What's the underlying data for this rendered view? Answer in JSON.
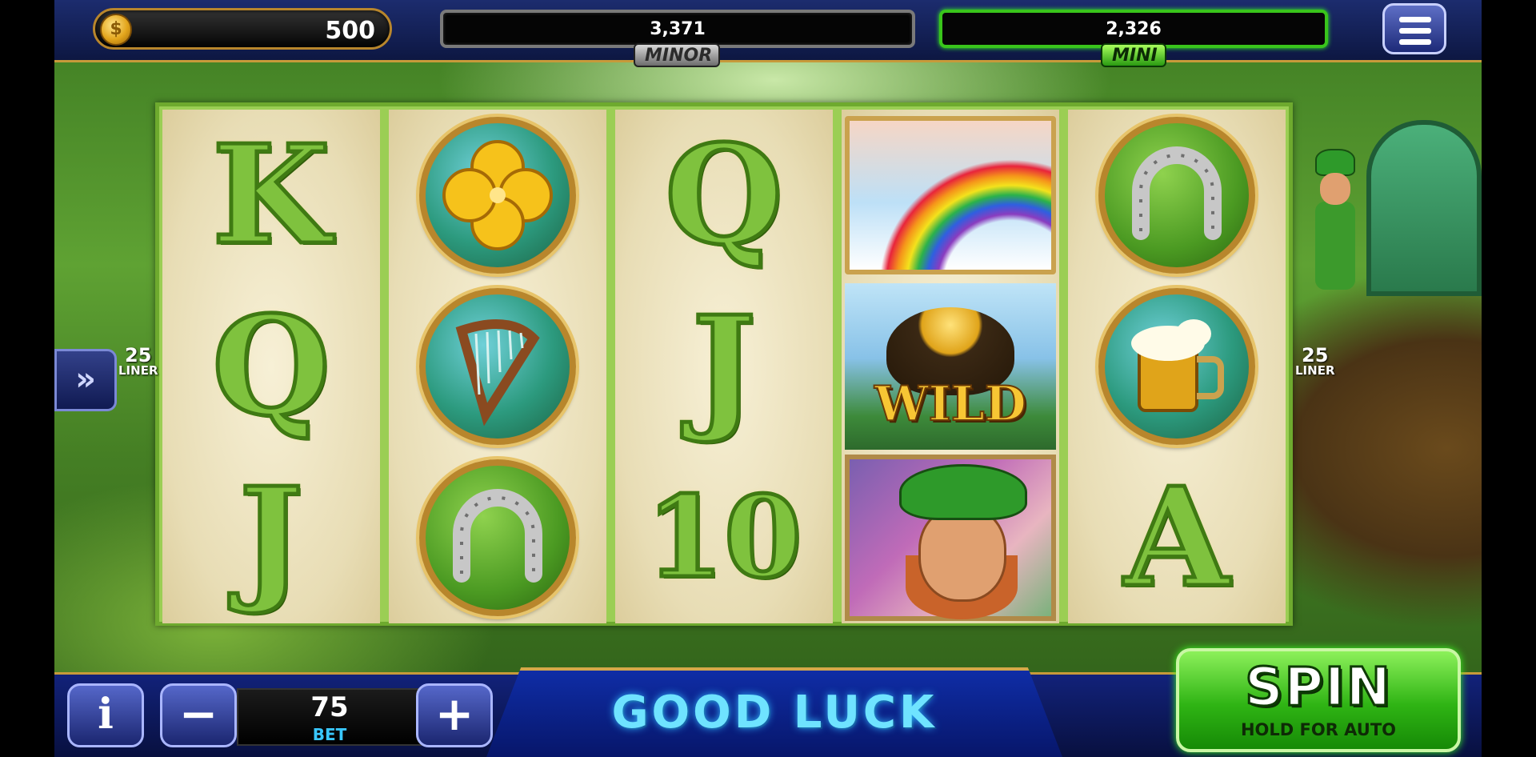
{
  "balance": {
    "coins": "500",
    "coin_icon": "dollar-coin-icon",
    "coin_symbol": "$"
  },
  "jackpots": [
    {
      "value": "3,371",
      "label": "MINOR"
    },
    {
      "value": "2,326",
      "label": "MINI"
    }
  ],
  "menu": {
    "icon": "hamburger-menu-icon"
  },
  "paylines": {
    "count": "25",
    "label": "LINER"
  },
  "side_button": {
    "glyph": "»"
  },
  "reels": [
    [
      {
        "type": "letter",
        "text": "K"
      },
      {
        "type": "letter",
        "text": "Q"
      },
      {
        "type": "letter",
        "text": "J"
      }
    ],
    [
      {
        "type": "symbol",
        "name": "golden-clover"
      },
      {
        "type": "symbol",
        "name": "harp"
      },
      {
        "type": "symbol",
        "name": "horseshoe"
      }
    ],
    [
      {
        "type": "letter",
        "text": "Q"
      },
      {
        "type": "letter",
        "text": "J"
      },
      {
        "type": "letter",
        "text": "10"
      }
    ],
    [
      {
        "type": "symbol",
        "name": "rainbow"
      },
      {
        "type": "wild",
        "text": "WILD"
      },
      {
        "type": "symbol",
        "name": "leprechaun"
      }
    ],
    [
      {
        "type": "symbol",
        "name": "horseshoe"
      },
      {
        "type": "symbol",
        "name": "beer-mug"
      },
      {
        "type": "letter",
        "text": "A"
      }
    ]
  ],
  "controls": {
    "info_label": "i",
    "minus_label": "−",
    "plus_label": "+",
    "bet_value": "75",
    "bet_label": "BET",
    "message": "GOOD LUCK",
    "spin_label": "SPIN",
    "spin_sub": "HOLD FOR AUTO"
  },
  "colors": {
    "accent_gold": "#c79a3a",
    "mini_green": "#39c51b",
    "message_cyan": "#6fe3ff"
  }
}
